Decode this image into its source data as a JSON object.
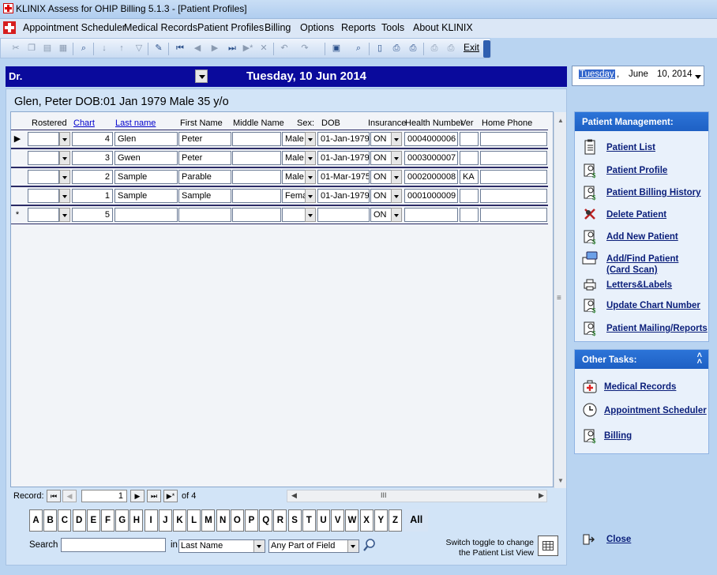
{
  "window": {
    "title": "KLINIX Assess for OHIP Billing 5.1.3 - [Patient Profiles]"
  },
  "menu": [
    "Appointment Scheduler",
    "Medical Records",
    "Patient Profiles",
    "Billing",
    "Options",
    "Reports",
    "Tools",
    "About KLINIX"
  ],
  "toolbar": {
    "exit_label": "Exit"
  },
  "doctor_bar": {
    "label": "Dr.",
    "date": "Tuesday,  10 Jun 2014"
  },
  "date_picker": {
    "weekday": "Tuesday",
    "separator": ",",
    "month": "June",
    "day": "10,",
    "year": "2014"
  },
  "patient_header": "Glen, Peter DOB:01 Jan 1979 Male 35 y/o",
  "grid": {
    "columns": {
      "rostered": "Rostered",
      "chart": "Chart",
      "last_name": "Last name",
      "first_name": "First Name",
      "middle_name": "Middle Name",
      "sex": "Sex:",
      "dob": "DOB",
      "insurance": "Insurance",
      "health_number": "Health Number",
      "ver": "Ver",
      "home_phone": "Home Phone"
    },
    "rows": [
      {
        "chart": "4",
        "last": "Glen",
        "first": "Peter",
        "middle": "",
        "sex": "Male",
        "dob": "01-Jan-1979",
        "ins": "ON",
        "hn": "0004000006",
        "ver": "",
        "phone": ""
      },
      {
        "chart": "3",
        "last": "Gwen",
        "first": "Peter",
        "middle": "",
        "sex": "Male",
        "dob": "01-Jan-1979",
        "ins": "ON",
        "hn": "0003000007",
        "ver": "",
        "phone": ""
      },
      {
        "chart": "2",
        "last": "Sample",
        "first": "Parable",
        "middle": "",
        "sex": "Male",
        "dob": "01-Mar-1975",
        "ins": "ON",
        "hn": "0002000008",
        "ver": "KA",
        "phone": ""
      },
      {
        "chart": "1",
        "last": "Sample",
        "first": "Sample",
        "middle": "",
        "sex": "Fema",
        "dob": "01-Jan-1979",
        "ins": "ON",
        "hn": "0001000009",
        "ver": "",
        "phone": ""
      }
    ],
    "new_row": {
      "marker": "*",
      "chart": "5",
      "ins": "ON"
    }
  },
  "record_nav": {
    "label": "Record:",
    "current": "1",
    "of": "of 4",
    "scroll_mid": "III"
  },
  "alphabet": [
    "A",
    "B",
    "C",
    "D",
    "E",
    "F",
    "G",
    "H",
    "I",
    "J",
    "K",
    "L",
    "M",
    "N",
    "O",
    "P",
    "Q",
    "R",
    "S",
    "T",
    "U",
    "V",
    "W",
    "X",
    "Y",
    "Z"
  ],
  "alpha_all": "All",
  "search": {
    "label": "Search",
    "value": "",
    "in_label": "in",
    "field": "Last Name",
    "match": "Any Part of Field"
  },
  "toggle": {
    "line1": "Switch toggle to change",
    "line2": "the Patient List View"
  },
  "patient_management": {
    "title": "Patient Management:",
    "items": [
      {
        "label": "Patient List",
        "icon": "clipboard-icon"
      },
      {
        "label": "Patient Profile",
        "icon": "patient-profile-icon"
      },
      {
        "label": "Patient Billing History",
        "icon": "billing-history-icon"
      },
      {
        "label": "Delete Patient",
        "icon": "delete-patient-icon"
      },
      {
        "label": "Add New Patient",
        "icon": "add-patient-icon"
      },
      {
        "label": "Add/Find Patient",
        "label2": "(Card Scan)",
        "icon": "card-scan-icon"
      },
      {
        "label": "Letters&Labels",
        "icon": "printer-icon"
      },
      {
        "label": "Update Chart Number",
        "icon": "update-chart-icon"
      },
      {
        "label": "Patient Mailing/Reports",
        "icon": "mailing-reports-icon"
      }
    ]
  },
  "other_tasks": {
    "title": "Other Tasks:",
    "collapse": "^",
    "items": [
      {
        "label": "Medical Records",
        "icon": "medical-kit-icon"
      },
      {
        "label": "Appointment Scheduler",
        "icon": "scheduler-icon"
      },
      {
        "label": "Billing",
        "icon": "billing-icon"
      }
    ]
  },
  "close_label": "Close"
}
